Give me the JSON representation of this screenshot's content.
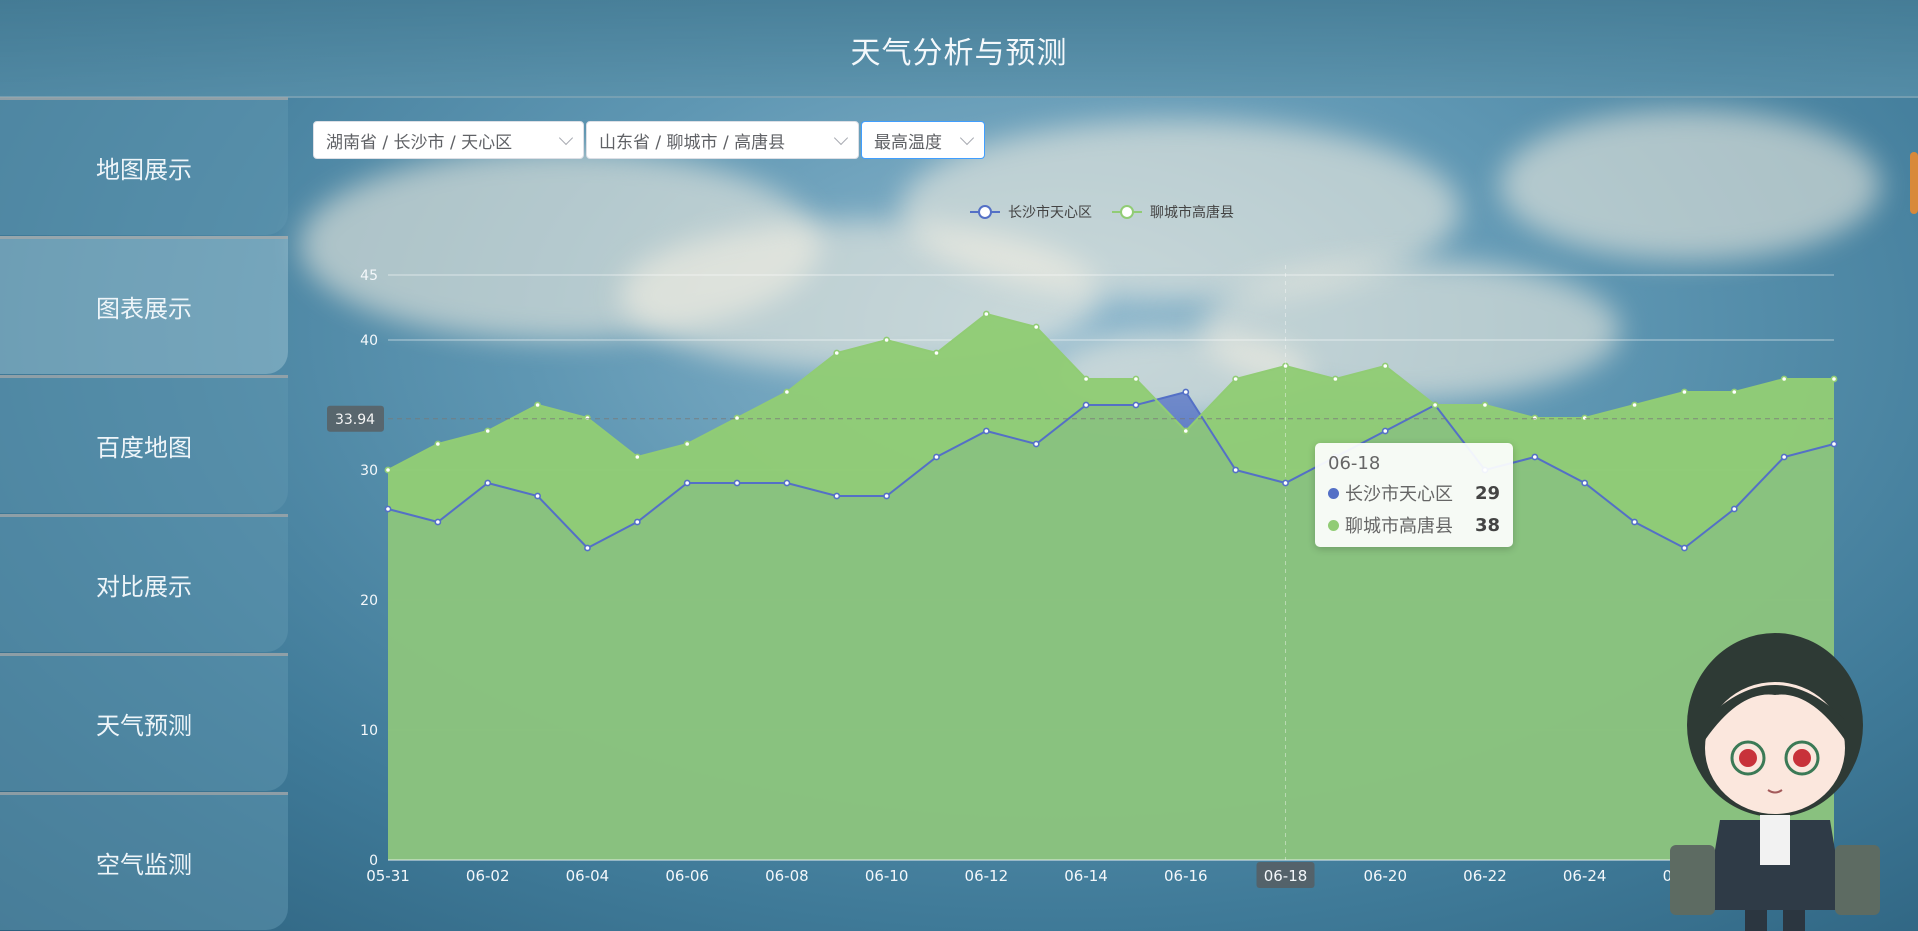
{
  "header": {
    "title": "天气分析与预测"
  },
  "sidebar": {
    "items": [
      {
        "label": "地图展示",
        "active": false
      },
      {
        "label": "图表展示",
        "active": true
      },
      {
        "label": "百度地图",
        "active": false
      },
      {
        "label": "对比展示",
        "active": false
      },
      {
        "label": "天气预测",
        "active": false
      },
      {
        "label": "空气监测",
        "active": false
      }
    ]
  },
  "selects": {
    "region_a": "湖南省 / 长沙市 / 天心区",
    "region_b": "山东省 / 聊城市 / 高唐县",
    "metric": "最高温度"
  },
  "tooltip": {
    "title": "06-18",
    "rows": [
      {
        "name": "长沙市天心区",
        "value": "29"
      },
      {
        "name": "聊城市高唐县",
        "value": "38"
      }
    ]
  },
  "chart_data": {
    "type": "area",
    "x": [
      "05-31",
      "06-01",
      "06-02",
      "06-03",
      "06-04",
      "06-05",
      "06-06",
      "06-07",
      "06-08",
      "06-09",
      "06-10",
      "06-11",
      "06-12",
      "06-13",
      "06-14",
      "06-15",
      "06-16",
      "06-17",
      "06-18",
      "06-19",
      "06-20",
      "06-21",
      "06-22",
      "06-23",
      "06-24",
      "06-25",
      "06-26",
      "06-27",
      "06-28",
      "06-29"
    ],
    "x_tick_labels": [
      "05-31",
      "06-02",
      "06-04",
      "06-06",
      "06-08",
      "06-10",
      "06-12",
      "06-14",
      "06-16",
      "06-18",
      "06-20",
      "06-22",
      "06-24",
      "06-26",
      "06-28"
    ],
    "series": [
      {
        "name": "长沙市天心区",
        "color": "#5470c6",
        "values": [
          27,
          26,
          29,
          28,
          24,
          26,
          29,
          29,
          29,
          28,
          28,
          31,
          33,
          32,
          35,
          35,
          36,
          30,
          29,
          31,
          33,
          35,
          30,
          31,
          29,
          26,
          24,
          27,
          31,
          32
        ]
      },
      {
        "name": "聊城市高唐县",
        "color": "#91cc75",
        "values": [
          30,
          32,
          33,
          35,
          34,
          31,
          32,
          34,
          36,
          39,
          40,
          39,
          42,
          41,
          37,
          37,
          33,
          37,
          38,
          37,
          38,
          35,
          35,
          34,
          34,
          35,
          36,
          36,
          37,
          37
        ]
      }
    ],
    "ylim": [
      0,
      45
    ],
    "y_ticks": [
      0,
      10,
      20,
      30,
      40,
      45
    ],
    "average_line": {
      "value": 33.94,
      "label": "33.94"
    },
    "highlight_x": "06-18",
    "legend_position": "top-center",
    "grid": true
  }
}
